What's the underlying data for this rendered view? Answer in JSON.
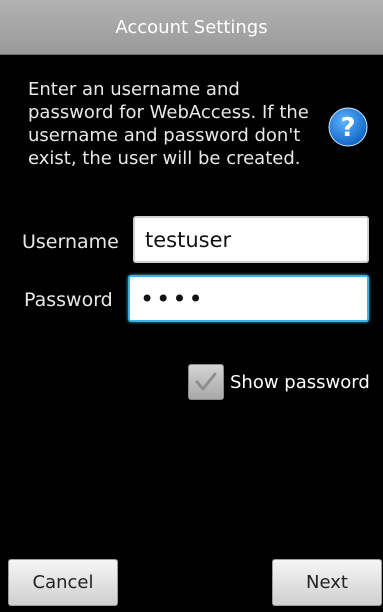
{
  "title_bar": {
    "title": "Account Settings"
  },
  "instructions": {
    "text": "Enter an username and password for WebAccess. If the username and password don't exist, the user will be created.",
    "help_icon": "question-mark-icon"
  },
  "form": {
    "username": {
      "label": "Username",
      "value": "testuser"
    },
    "password": {
      "label": "Password",
      "masked_value": "••••"
    },
    "show_password": {
      "label": "Show password",
      "checked": true
    }
  },
  "buttons": {
    "cancel_label": "Cancel",
    "next_label": "Next"
  },
  "colors": {
    "background": "#000000",
    "title_bar": "#a6a6a6",
    "focus_border": "#39b2e6",
    "help_icon": "#1a7fd6"
  }
}
